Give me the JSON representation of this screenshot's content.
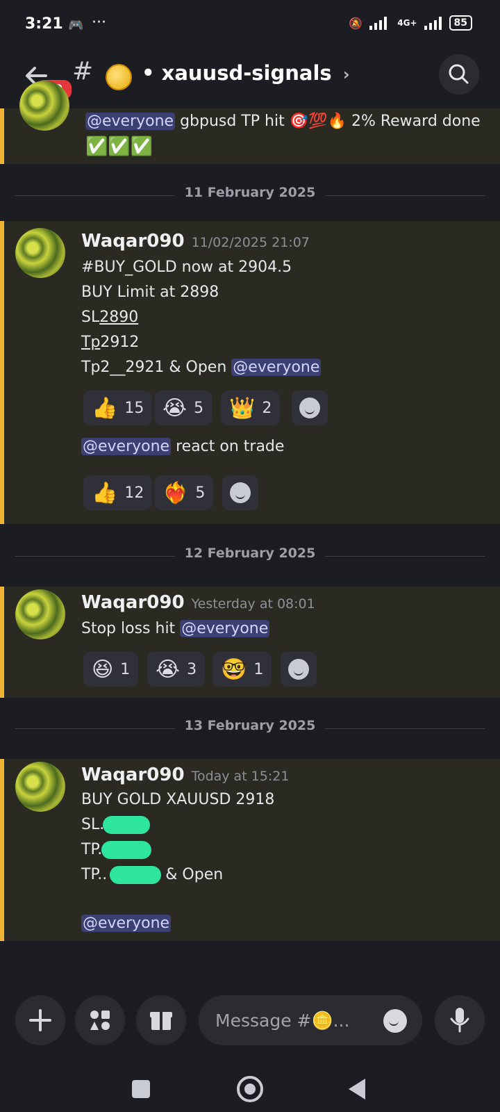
{
  "status_bar": {
    "time": "3:21",
    "network": "4G+",
    "battery": "85"
  },
  "header": {
    "unread_badge": "99",
    "channel_name": "xauusd-signals",
    "chevron": "›"
  },
  "top_partial": {
    "mention": "@everyone",
    "text_1": "gbpusd TP hit",
    "emoji_1": "🎯",
    "emoji_2": "💯",
    "emoji_3": "🔥",
    "text_2": "2% Reward done",
    "checks": "✅✅✅"
  },
  "dividers": [
    "11 February 2025",
    "12 February 2025",
    "13 February 2025"
  ],
  "messages": [
    {
      "username": "Waqar090",
      "timestamp": "11/02/2025 21:07",
      "line1": "#BUY_GOLD now at 2904.5",
      "line2": "BUY Limit at 2898",
      "line3_prefix": "SL",
      "line3_value": "2890",
      "line4_prefix": "Tp",
      "line4_value": "2912",
      "line5": "Tp2__2921 & Open",
      "mention": "@everyone",
      "reactions": [
        {
          "emoji": "👍",
          "count": "15"
        },
        {
          "emoji": "😭",
          "count": "5"
        },
        {
          "emoji": "👑",
          "count": "2"
        }
      ],
      "followup_mention": "@everyone",
      "followup_text": "react on trade",
      "followup_reactions": [
        {
          "emoji": "👍",
          "count": "12"
        },
        {
          "emoji": "❤️‍🔥",
          "count": "5"
        }
      ]
    },
    {
      "username": "Waqar090",
      "timestamp": "Yesterday at 08:01",
      "text": "Stop loss hit",
      "mention": "@everyone",
      "reactions": [
        {
          "emoji": "😆",
          "count": "1"
        },
        {
          "emoji": "😭",
          "count": "3"
        },
        {
          "emoji": "🤓",
          "count": "1"
        }
      ]
    },
    {
      "username": "Waqar090",
      "timestamp": "Today at 15:21",
      "line1": "BUY GOLD XAUUSD 2918",
      "line2": "SL..",
      "line3": "TP..",
      "line4_prefix": "TP..",
      "line4_suffix": "& Open",
      "mention": "@everyone"
    }
  ],
  "composer": {
    "placeholder": "Message #🪙..."
  },
  "colors": {
    "accent_bar": "#f0b232",
    "mention_bg": "#3c3f72",
    "redaction": "#2ee59d",
    "badge": "#e5373c"
  }
}
